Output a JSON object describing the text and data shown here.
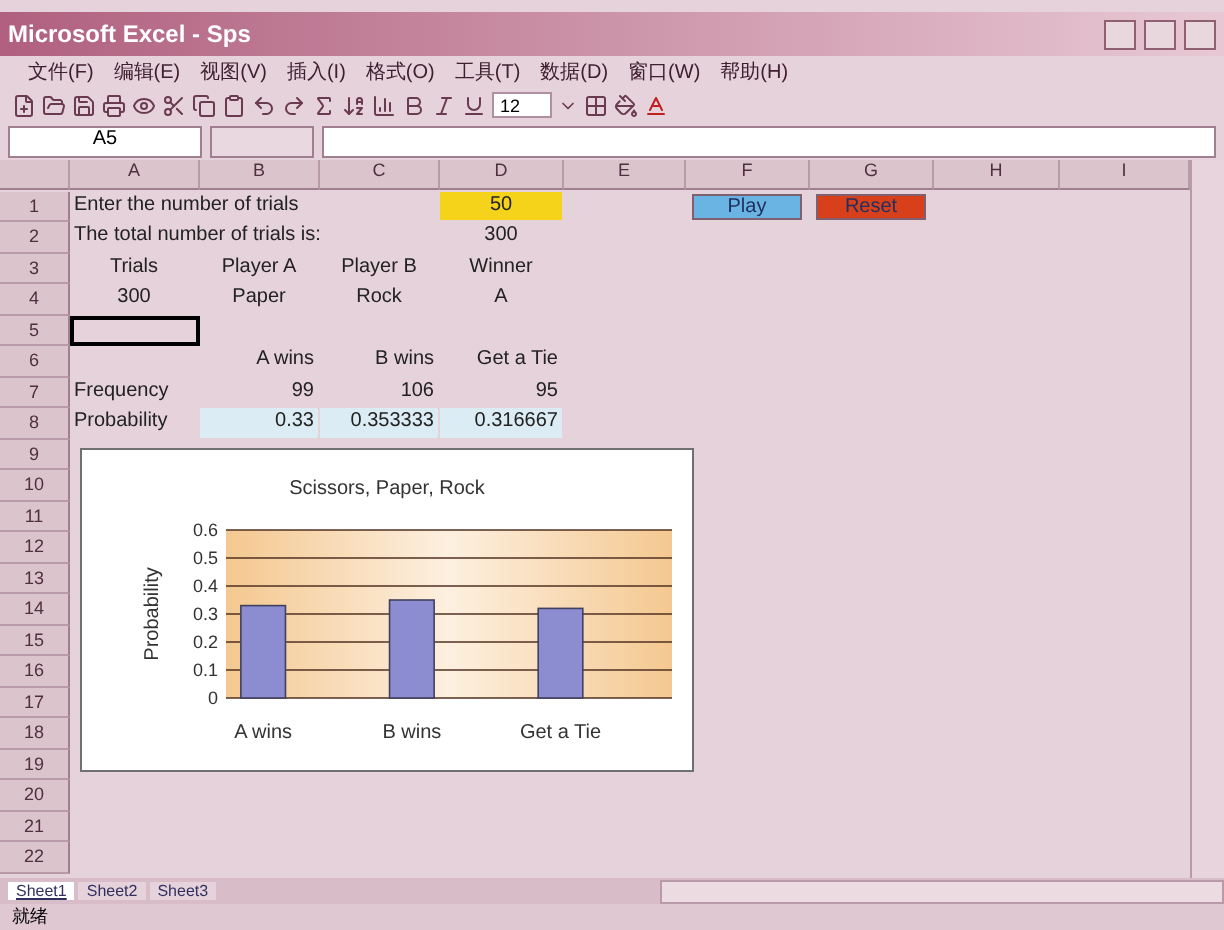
{
  "window": {
    "title": "Microsoft Excel - Sps"
  },
  "menu": [
    "文件(F)",
    "编辑(E)",
    "视图(V)",
    "插入(I)",
    "格式(O)",
    "工具(T)",
    "数据(D)",
    "窗口(W)",
    "帮助(H)"
  ],
  "toolbar": {
    "font_size": "12"
  },
  "name_box": "A5",
  "columns": [
    "A",
    "B",
    "C",
    "D",
    "E",
    "F",
    "G",
    "H",
    "I"
  ],
  "rows": [
    {
      "number": "1",
      "cells": {
        "A": {
          "text": "Enter the number of trials",
          "kind": "label"
        },
        "D": {
          "text": "50",
          "kind": "header",
          "color": "#f5d31a"
        }
      }
    },
    {
      "number": "2",
      "cells": {
        "A": {
          "text": "The total number of trials is:",
          "kind": "label"
        },
        "D": {
          "text": "300",
          "kind": "header"
        }
      }
    },
    {
      "number": "3",
      "cells": {
        "A": {
          "text": "Trials",
          "kind": "header"
        },
        "B": {
          "text": "Player A",
          "kind": "header"
        },
        "C": {
          "text": "Player B",
          "kind": "header"
        },
        "D": {
          "text": "Winner",
          "kind": "header"
        }
      }
    },
    {
      "number": "4",
      "cells": {
        "A": {
          "text": "300",
          "kind": "header"
        },
        "B": {
          "text": "Paper",
          "kind": "header"
        },
        "C": {
          "text": "Rock",
          "kind": "header"
        },
        "D": {
          "text": "A",
          "kind": "header"
        }
      }
    },
    {
      "number": "5",
      "cells": {
        "A": {
          "kind": "empty",
          "selected": true
        }
      }
    },
    {
      "number": "6",
      "cells": {
        "B": {
          "text": "A wins",
          "kind": "number"
        },
        "C": {
          "text": "B wins",
          "kind": "number"
        },
        "D": {
          "text": "Get a Tie",
          "kind": "number"
        }
      }
    },
    {
      "number": "7",
      "cells": {
        "A": {
          "text": "Frequency",
          "kind": "label"
        },
        "B": {
          "text": "99",
          "kind": "number"
        },
        "C": {
          "text": "106",
          "kind": "number"
        },
        "D": {
          "text": "95",
          "kind": "number"
        }
      }
    },
    {
      "number": "8",
      "cells": {
        "A": {
          "text": "Probability",
          "kind": "label"
        },
        "B": {
          "text": "0.33",
          "kind": "number",
          "color": "#dcecf4"
        },
        "C": {
          "text": "0.353333",
          "kind": "number",
          "color": "#dcecf4"
        },
        "D": {
          "text": "0.316667",
          "kind": "number",
          "color": "#dcecf4"
        }
      }
    },
    {
      "number": "9"
    },
    {
      "number": "10"
    },
    {
      "number": "11"
    },
    {
      "number": "12"
    },
    {
      "number": "13"
    },
    {
      "number": "14"
    },
    {
      "number": "15"
    },
    {
      "number": "16"
    },
    {
      "number": "17"
    },
    {
      "number": "18"
    },
    {
      "number": "19"
    },
    {
      "number": "20"
    },
    {
      "number": "21"
    },
    {
      "number": "22"
    }
  ],
  "buttons": [
    {
      "label": "Play",
      "color": "#6ab4e4"
    },
    {
      "label": "Reset",
      "color": "#d8401c"
    }
  ],
  "chart": {
    "chart_data": {
      "type": "bar",
      "title": "Scissors, Paper, Rock",
      "ylabel": "Probability",
      "categories": [
        "A wins",
        "B wins",
        "Get a Tie"
      ],
      "series": [
        {
          "color": "#8c8cd0",
          "values": [
            0.33,
            0.35,
            0.32
          ]
        }
      ],
      "ylim": [
        0,
        0.6
      ],
      "yticks": [
        0,
        0.1,
        0.2,
        0.3,
        0.4,
        0.5,
        0.6
      ],
      "grid": true
    }
  },
  "sheet_tabs": [
    {
      "label": "Sheet1",
      "selected": true
    },
    {
      "label": "Sheet2",
      "selected": false
    },
    {
      "label": "Sheet3",
      "selected": false
    }
  ],
  "status_bar": "就绪"
}
